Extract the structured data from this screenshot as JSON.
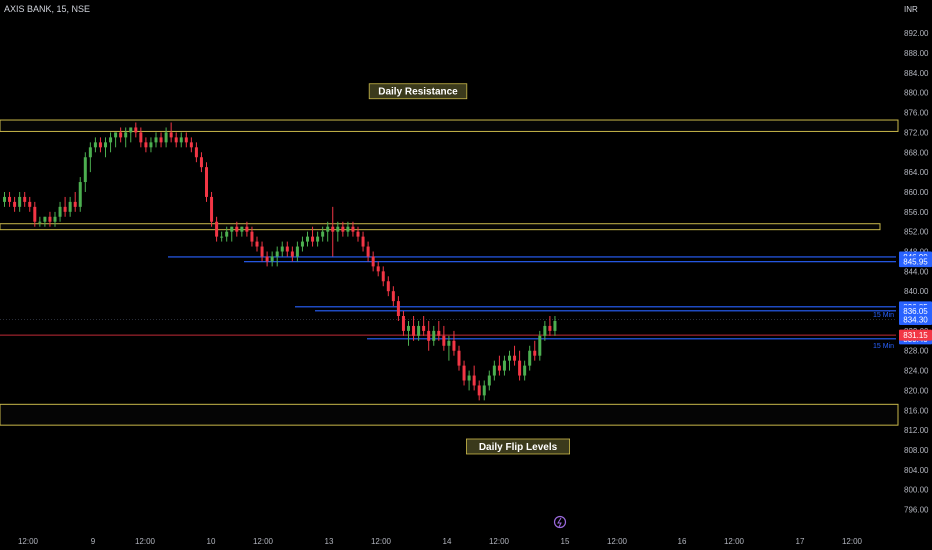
{
  "header": {
    "symbol": "AXIS BANK, 15, NSE",
    "currency": "INR"
  },
  "chart_data": {
    "type": "candlestick",
    "ylim": [
      795,
      898
    ],
    "y_ticks": [
      796,
      800,
      804,
      808,
      812,
      816,
      820,
      824,
      828,
      832,
      836,
      840,
      844,
      848,
      852,
      856,
      860,
      864,
      868,
      872,
      876,
      880,
      884,
      888,
      892
    ],
    "x_ticks": [
      "12:00",
      "9",
      "12:00",
      "10",
      "12:00",
      "13",
      "12:00",
      "14",
      "12:00",
      "15",
      "12:00",
      "16",
      "12:00",
      "17",
      "12:00"
    ],
    "grid": false,
    "colors": {
      "up": "#4caf50",
      "down": "#f23645",
      "zone": "#c9b84a",
      "level": "#2962ff",
      "price": "#f23645",
      "label_bg": "#3b3a1c",
      "label_text": "#ffffff"
    },
    "zones": [
      {
        "label": "Daily Resistance",
        "low": 872.2,
        "high": 874.5
      },
      {
        "label": "",
        "low": 852.4,
        "high": 853.6
      },
      {
        "label": "Daily Flip Levels",
        "low": 813.0,
        "high": 817.2
      }
    ],
    "levels": [
      {
        "value": 846.9,
        "label": "846.90"
      },
      {
        "value": 845.95,
        "label": "845.95"
      },
      {
        "value": 836.85,
        "label": "836.85"
      },
      {
        "value": 836.05,
        "label": "836.05"
      },
      {
        "value": 834.3,
        "label": "834.30"
      },
      {
        "value": 830.4,
        "label": "830.40"
      }
    ],
    "last_price": {
      "value": 831.15,
      "label": "831.15"
    },
    "level_annotations": [
      {
        "value": 836.05,
        "text": "15 Min"
      },
      {
        "value": 830.4,
        "text": "15 Min"
      }
    ],
    "candles": [
      [
        858,
        860,
        857,
        859
      ],
      [
        859,
        860,
        857,
        858
      ],
      [
        858,
        859,
        856,
        857
      ],
      [
        857,
        860,
        856,
        859
      ],
      [
        859,
        860,
        857,
        858
      ],
      [
        858,
        859,
        856,
        857
      ],
      [
        857,
        858,
        853,
        854
      ],
      [
        854,
        855,
        853,
        854
      ],
      [
        854,
        855,
        853,
        855
      ],
      [
        855,
        856,
        853,
        854
      ],
      [
        854,
        856,
        853,
        855
      ],
      [
        855,
        858,
        854,
        857
      ],
      [
        857,
        859,
        855,
        856
      ],
      [
        856,
        859,
        855,
        858
      ],
      [
        858,
        860,
        856,
        857
      ],
      [
        857,
        863,
        856,
        862
      ],
      [
        862,
        868,
        860,
        867
      ],
      [
        867,
        870,
        864,
        869
      ],
      [
        869,
        871,
        868,
        870
      ],
      [
        870,
        871,
        868,
        869
      ],
      [
        869,
        871,
        867,
        870
      ],
      [
        870,
        872,
        868,
        871
      ],
      [
        871,
        872,
        869,
        872
      ],
      [
        872,
        873,
        870,
        871
      ],
      [
        871,
        873,
        869,
        872
      ],
      [
        872,
        873,
        870,
        873
      ],
      [
        873,
        874,
        871,
        872
      ],
      [
        872,
        873,
        869,
        870
      ],
      [
        870,
        871,
        868,
        869
      ],
      [
        869,
        871,
        868,
        870
      ],
      [
        870,
        872,
        869,
        871
      ],
      [
        871,
        872,
        869,
        870
      ],
      [
        870,
        873,
        869,
        872
      ],
      [
        872,
        874,
        870,
        871
      ],
      [
        871,
        872,
        869,
        870
      ],
      [
        870,
        872,
        869,
        871
      ],
      [
        871,
        872,
        869,
        870
      ],
      [
        870,
        871,
        868,
        869
      ],
      [
        869,
        870,
        866,
        867
      ],
      [
        867,
        868,
        864,
        865
      ],
      [
        865,
        866,
        858,
        859
      ],
      [
        859,
        860,
        853,
        854
      ],
      [
        854,
        855,
        850,
        851
      ],
      [
        851,
        852,
        850,
        851
      ],
      [
        851,
        853,
        850,
        852
      ],
      [
        852,
        853,
        850,
        853
      ],
      [
        853,
        854,
        851,
        852
      ],
      [
        852,
        853,
        851,
        853
      ],
      [
        853,
        854,
        851,
        852
      ],
      [
        852,
        853,
        849,
        850
      ],
      [
        850,
        851,
        848,
        849
      ],
      [
        849,
        850,
        846,
        847
      ],
      [
        847,
        848,
        845,
        846
      ],
      [
        846,
        848,
        845,
        847
      ],
      [
        847,
        849,
        845,
        848
      ],
      [
        848,
        850,
        847,
        849
      ],
      [
        849,
        850,
        847,
        848
      ],
      [
        848,
        849,
        846,
        847
      ],
      [
        847,
        850,
        846,
        849
      ],
      [
        849,
        851,
        848,
        850
      ],
      [
        850,
        852,
        849,
        851
      ],
      [
        851,
        853,
        849,
        850
      ],
      [
        850,
        852,
        849,
        851
      ],
      [
        851,
        853,
        850,
        852
      ],
      [
        852,
        854,
        850,
        853
      ],
      [
        853,
        857,
        847,
        852
      ],
      [
        852,
        854,
        850,
        853
      ],
      [
        853,
        854,
        851,
        852
      ],
      [
        852,
        854,
        851,
        853
      ],
      [
        853,
        854,
        851,
        852
      ],
      [
        852,
        853,
        850,
        851
      ],
      [
        851,
        852,
        848,
        849
      ],
      [
        849,
        850,
        846,
        847
      ],
      [
        847,
        848,
        844,
        845
      ],
      [
        845,
        846,
        843,
        844
      ],
      [
        844,
        845,
        841,
        842
      ],
      [
        842,
        843,
        839,
        840
      ],
      [
        840,
        841,
        837,
        838
      ],
      [
        838,
        839,
        834,
        835
      ],
      [
        835,
        836,
        831,
        832
      ],
      [
        832,
        834,
        829,
        833
      ],
      [
        833,
        835,
        830,
        831
      ],
      [
        831,
        834,
        830,
        833
      ],
      [
        833,
        835,
        831,
        832
      ],
      [
        832,
        834,
        828,
        830
      ],
      [
        830,
        833,
        829,
        832
      ],
      [
        832,
        834,
        830,
        831
      ],
      [
        831,
        833,
        828,
        829
      ],
      [
        829,
        831,
        826,
        830
      ],
      [
        830,
        832,
        827,
        828
      ],
      [
        828,
        829,
        824,
        825
      ],
      [
        825,
        826,
        821,
        822
      ],
      [
        822,
        824,
        820,
        823
      ],
      [
        823,
        825,
        820,
        821
      ],
      [
        821,
        822,
        818,
        819
      ],
      [
        819,
        822,
        818,
        821
      ],
      [
        821,
        824,
        820,
        823
      ],
      [
        823,
        826,
        822,
        825
      ],
      [
        825,
        827,
        823,
        824
      ],
      [
        824,
        827,
        823,
        826
      ],
      [
        826,
        828,
        824,
        827
      ],
      [
        827,
        829,
        825,
        826
      ],
      [
        826,
        828,
        822,
        823
      ],
      [
        823,
        826,
        822,
        825
      ],
      [
        825,
        829,
        824,
        828
      ],
      [
        828,
        830,
        826,
        827
      ],
      [
        827,
        832,
        826,
        831
      ],
      [
        831,
        834,
        830,
        833
      ],
      [
        833,
        835,
        831,
        832
      ],
      [
        832,
        835,
        831,
        834
      ]
    ]
  }
}
